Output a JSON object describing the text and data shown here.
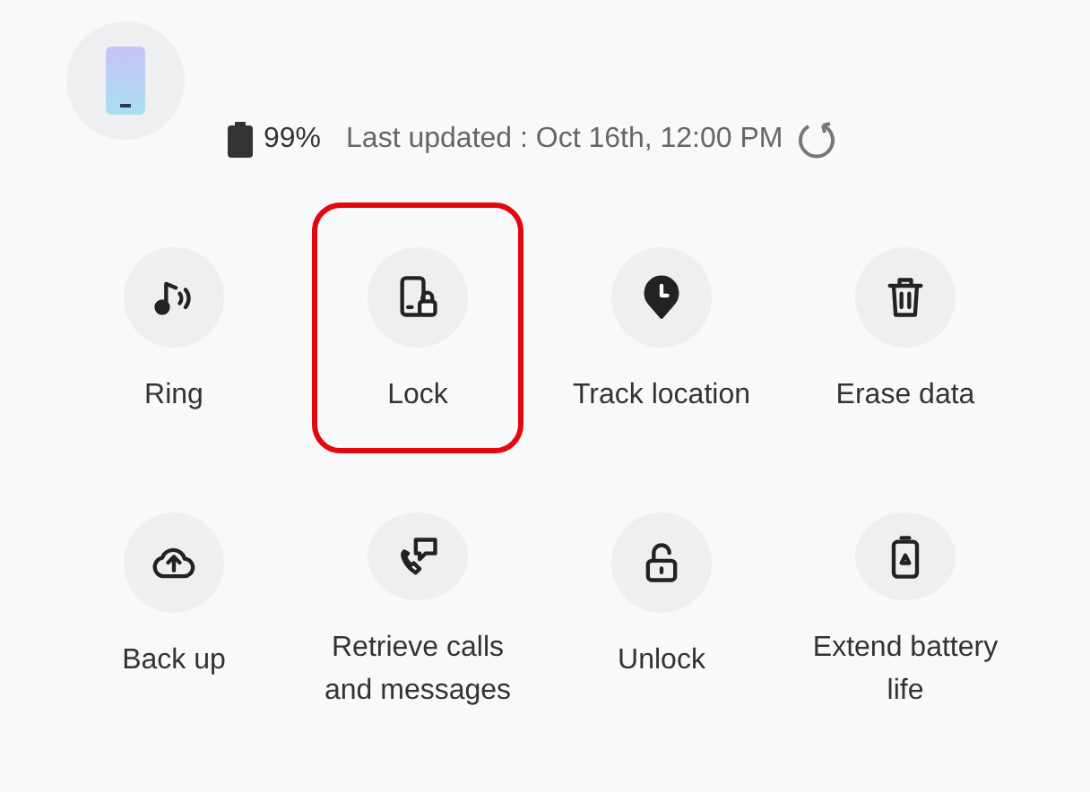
{
  "device": {
    "battery": "99%",
    "last_updated": "Last updated : Oct 16th, 12:00 PM"
  },
  "actions": [
    {
      "kind": "ring",
      "label": "Ring",
      "selected": false
    },
    {
      "kind": "lock",
      "label": "Lock",
      "selected": true
    },
    {
      "kind": "track",
      "label": "Track location",
      "selected": false
    },
    {
      "kind": "erase",
      "label": "Erase data",
      "selected": false
    },
    {
      "kind": "backup",
      "label": "Back up",
      "selected": false
    },
    {
      "kind": "retrieve",
      "label": "Retrieve calls and messages",
      "selected": false
    },
    {
      "kind": "unlock",
      "label": "Unlock",
      "selected": false
    },
    {
      "kind": "battery",
      "label": "Extend battery life",
      "selected": false
    }
  ]
}
